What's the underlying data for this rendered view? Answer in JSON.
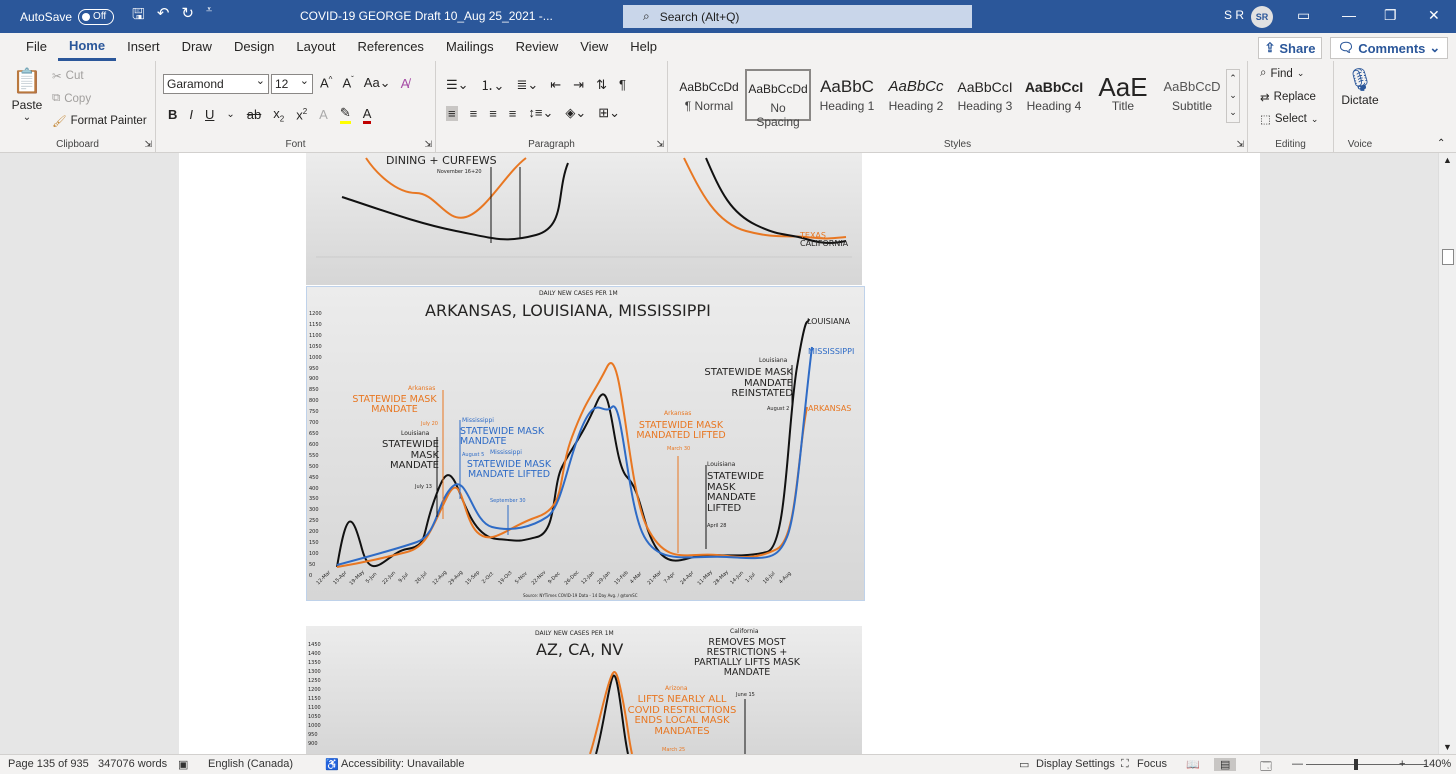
{
  "titlebar": {
    "autosave_label": "AutoSave",
    "autosave_state": "Off",
    "doc_title": "COVID-19 GEORGE Draft 10_Aug 25_2021  -...",
    "search_placeholder": "Search (Alt+Q)",
    "user_name": "S R",
    "user_initials": "SR"
  },
  "tabs": [
    "File",
    "Home",
    "Insert",
    "Draw",
    "Design",
    "Layout",
    "References",
    "Mailings",
    "Review",
    "View",
    "Help"
  ],
  "share_label": "Share",
  "comments_label": "Comments",
  "clipboard": {
    "paste": "Paste",
    "cut": "Cut",
    "copy": "Copy",
    "format_painter": "Format Painter",
    "label": "Clipboard"
  },
  "font": {
    "family": "Garamond",
    "size": "12",
    "label": "Font"
  },
  "paragraph": {
    "label": "Paragraph"
  },
  "styles": {
    "label": "Styles",
    "items": [
      {
        "sample": "AaBbCcDd",
        "name": "¶ Normal"
      },
      {
        "sample": "AaBbCcDd",
        "name": "No Spacing"
      },
      {
        "sample": "AaBbC",
        "name": "Heading 1"
      },
      {
        "sample": "AaBbCc",
        "name": "Heading 2"
      },
      {
        "sample": "AaBbCcI",
        "name": "Heading 3"
      },
      {
        "sample": "AaBbCcI",
        "name": "Heading 4"
      },
      {
        "sample": "AaE",
        "name": "Title"
      },
      {
        "sample": "AaBbCcD",
        "name": "Subtitle"
      }
    ]
  },
  "editing": {
    "find": "Find",
    "replace": "Replace",
    "select": "Select",
    "label": "Editing"
  },
  "voice": {
    "dictate": "Dictate",
    "label": "Voice"
  },
  "doc": {
    "chart1": {
      "annotation": "DINING + CURFEWS",
      "annotation_date": "November 16+20",
      "texas": "TEXAS",
      "california": "CALIFORNIA"
    },
    "chart2": {
      "subtitle": "DAILY NEW CASES PER 1M",
      "title": "ARKANSAS, LOUISIANA, MISSISSIPPI",
      "yticks": [
        "1200",
        "1150",
        "1100",
        "1050",
        "1000",
        "950",
        "900",
        "850",
        "800",
        "750",
        "700",
        "650",
        "600",
        "550",
        "500",
        "450",
        "400",
        "350",
        "300",
        "250",
        "200",
        "150",
        "100",
        "50",
        "0"
      ],
      "xticks": [
        "12-Mar",
        "15-Apr",
        "19-May",
        "5-Jun",
        "22-Jun",
        "9-Jul",
        "26-Jul",
        "12-Aug",
        "29-Aug",
        "15-Sep",
        "2-Oct",
        "19-Oct",
        "5-Nov",
        "22-Nov",
        "9-Dec",
        "26-Dec",
        "12-Jan",
        "29-Jan",
        "15-Feb",
        "4-Mar",
        "21-Mar",
        "7-Apr",
        "24-Apr",
        "11-May",
        "28-May",
        "14-Jun",
        "1-Jul",
        "18-Jul",
        "4-Aug"
      ],
      "legend_louisiana": "LOUISIANA",
      "legend_mississippi": "MISSISSIPPI",
      "legend_arkansas": "ARKANSAS",
      "ann_ar_state": "Arkansas",
      "ann_ar_text": "STATEWIDE MASK MANDATE",
      "ann_ar_date": "July 20",
      "ann_la_state": "Louisiana",
      "ann_la_text": "STATEWIDE MASK MANDATE",
      "ann_la_date": "July 13",
      "ann_ms_state": "Mississippi",
      "ann_ms_text": "STATEWIDE MASK MANDATE",
      "ann_ms_date": "August 5",
      "ann_ms2_state": "Mississippi",
      "ann_ms2_text": "STATEWIDE MASK MANDATE LIFTED",
      "ann_ms2_date": "September 30",
      "ann_ar2_state": "Arkansas",
      "ann_ar2_text": "STATEWIDE MASK MANDATED LIFTED",
      "ann_ar2_date": "March 30",
      "ann_la2_state": "Louisiana",
      "ann_la2_text": "STATEWIDE MASK MANDATE LIFTED",
      "ann_la2_date": "April 28",
      "ann_la3_state": "Louisiana",
      "ann_la3_text": "STATEWIDE MASK MANDATE REINSTATED",
      "ann_la3_date": "August 2",
      "source": "Source: NYTimes COVID-19 Data - 14 Day Avg. / @tomSC"
    },
    "chart3": {
      "subtitle": "DAILY NEW CASES PER 1M",
      "title": "AZ, CA, NV",
      "yticks": [
        "1450",
        "1400",
        "1350",
        "1300",
        "1250",
        "1200",
        "1150",
        "1100",
        "1050",
        "1000",
        "950",
        "900"
      ],
      "ann_ca_state": "California",
      "ann_ca_text": "REMOVES MOST RESTRICTIONS + PARTIALLY LIFTS MASK MANDATE",
      "ann_ca_date": "June 15",
      "ann_az_state": "Arizona",
      "ann_az_text": "LIFTS NEARLY ALL COVID RESTRICTIONS ENDS LOCAL MASK MANDATES",
      "ann_az_date": "March 25"
    }
  },
  "status": {
    "page": "Page 135 of 935",
    "words": "347076 words",
    "language": "English (Canada)",
    "accessibility": "Accessibility: Unavailable",
    "display": "Display Settings",
    "focus": "Focus",
    "zoom": "140%"
  }
}
